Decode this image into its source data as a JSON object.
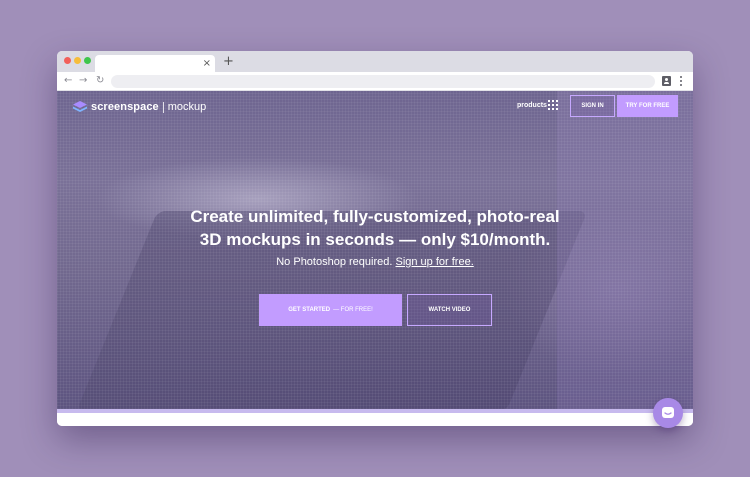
{
  "browser": {
    "tab_close": "×",
    "new_tab": "+",
    "back": "←",
    "forward": "→",
    "reload": "↻"
  },
  "header": {
    "logo_brand": "screenspace",
    "logo_product": "mockup",
    "products_label": "products",
    "signin_label": "SIGN IN",
    "try_label": "TRY FOR FREE"
  },
  "hero": {
    "headline_line1": "Create unlimited, fully-customized, photo-real",
    "headline_line2": "3D mockups in seconds — only $10/month.",
    "sub_text": "No Photoshop required.",
    "sub_link": "Sign up for free.",
    "start_label": "GET STARTED",
    "start_suffix": "— FOR FREE!",
    "video_label": "WATCH VIDEO"
  },
  "colors": {
    "background": "#a08fb9",
    "accent": "#c29cff",
    "hero_overlay": "#6e6590"
  },
  "icons": {
    "logo": "layers-icon",
    "products": "grid-icon",
    "chat": "chat-icon",
    "profile": "profile-icon",
    "menu": "kebab-menu-icon"
  }
}
